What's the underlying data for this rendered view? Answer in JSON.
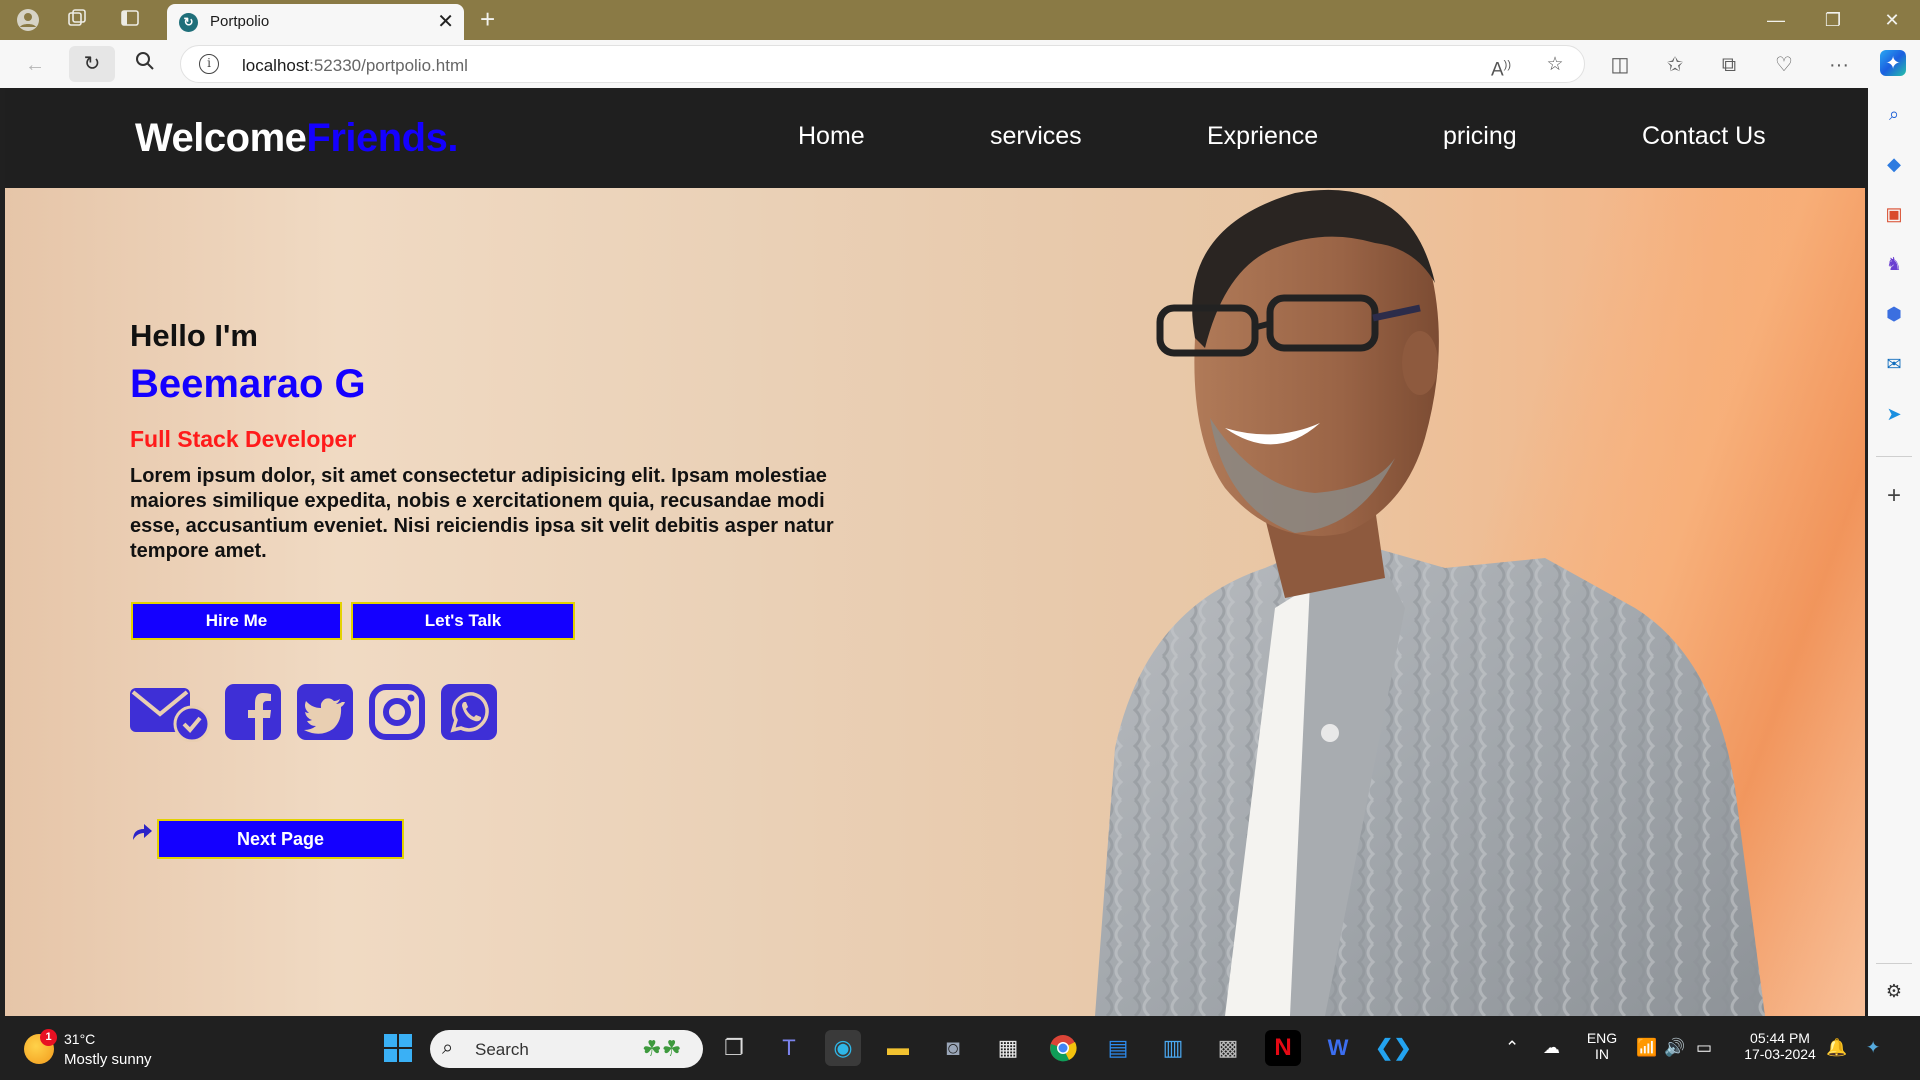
{
  "browser": {
    "tab_title": "Portpolio",
    "address": {
      "host": "localhost",
      "rest": ":52330/portpolio.html"
    }
  },
  "site": {
    "logo": {
      "main": "Welcome",
      "accent": "Friends."
    },
    "menu": [
      "Home",
      "services",
      "Exprience",
      "pricing",
      "Contact Us"
    ],
    "hero": {
      "greeting": "Hello I'm",
      "name": "Beemarao G",
      "role": "Full Stack Developer",
      "description": "Lorem ipsum dolor, sit amet consectetur adipisicing elit. Ipsam molestiae maiores similique expedita, nobis e xercitationem quia, recusandae modi esse, accusantium eveniet. Nisi reiciendis ipsa sit velit debitis asper natur tempore amet.",
      "hire_label": "Hire Me",
      "talk_label": "Let's Talk",
      "next_label": "Next Page",
      "social_icons": [
        "mail-check-icon",
        "facebook-icon",
        "twitter-icon",
        "instagram-icon",
        "whatsapp-icon"
      ]
    }
  },
  "taskbar": {
    "weather_temp": "31°C",
    "weather_desc": "Mostly sunny",
    "weather_badge": "1",
    "search_label": "Search",
    "lang_top": "ENG",
    "lang_bottom": "IN",
    "time": "05:44 PM",
    "date": "17-03-2024"
  },
  "colors": {
    "accent_blue": "#1400ff",
    "role_red": "#ff1a1a",
    "button_border": "#e3d200",
    "nav_bg": "#1f1f1f"
  }
}
